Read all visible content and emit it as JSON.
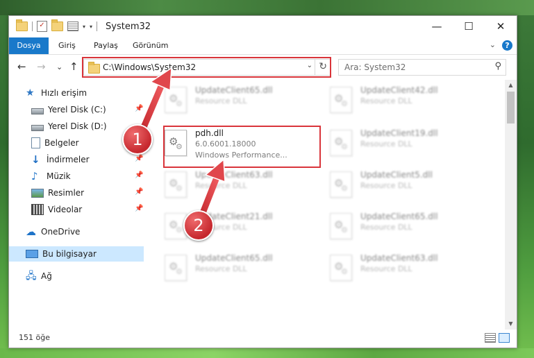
{
  "titlebar": {
    "title": "System32",
    "quick_access_dropdown_glyph": "▾",
    "customize_glyph": "▾",
    "minimize_glyph": "—",
    "maximize_glyph": "☐",
    "close_glyph": "✕"
  },
  "ribbon": {
    "tabs": [
      "Dosya",
      "Giriş",
      "Paylaş",
      "Görünüm"
    ],
    "expand_glyph": "⌄",
    "help_glyph": "?"
  },
  "nav": {
    "back_glyph": "←",
    "forward_glyph": "→",
    "recent_glyph": "⌄",
    "up_glyph": "↑"
  },
  "address": {
    "path": "C:\\Windows\\System32",
    "dropdown_glyph": "⌄",
    "refresh_glyph": "↻"
  },
  "search": {
    "placeholder": "Ara: System32",
    "search_glyph": "⚲"
  },
  "sidebar": {
    "items": [
      {
        "label": "Hızlı erişim",
        "icon": "star-icon",
        "pinned": false,
        "selected": false
      },
      {
        "label": "Yerel Disk (C:)",
        "icon": "drive-icon",
        "pinned": true,
        "selected": false
      },
      {
        "label": "Yerel Disk (D:)",
        "icon": "drive-icon",
        "pinned": false,
        "selected": false
      },
      {
        "label": "Belgeler",
        "icon": "documents-icon",
        "pinned": true,
        "selected": false
      },
      {
        "label": "İndirmeler",
        "icon": "downloads-icon",
        "pinned": true,
        "selected": false
      },
      {
        "label": "Müzik",
        "icon": "music-icon",
        "pinned": true,
        "selected": false
      },
      {
        "label": "Resimler",
        "icon": "pictures-icon",
        "pinned": true,
        "selected": false
      },
      {
        "label": "Videolar",
        "icon": "videos-icon",
        "pinned": true,
        "selected": false
      },
      {
        "label": "OneDrive",
        "icon": "onedrive-icon",
        "pinned": false,
        "selected": false
      },
      {
        "label": "Bu bilgisayar",
        "icon": "this-pc-icon",
        "pinned": false,
        "selected": true
      },
      {
        "label": "Ağ",
        "icon": "network-icon",
        "pinned": false,
        "selected": false
      }
    ],
    "pin_glyph": "📌"
  },
  "files": {
    "left_column": [
      {
        "name": "UpdateClient65.dll",
        "line1": "Resource DLL",
        "line2": "",
        "blurred": true
      },
      {
        "name": "pdh.dll",
        "line1": "6.0.6001.18000",
        "line2": "Windows Performance...",
        "blurred": false,
        "highlighted": true
      },
      {
        "name": "UpdateClient63.dll",
        "line1": "Resource DLL",
        "line2": "",
        "blurred": true
      },
      {
        "name": "UpdateClient21.dll",
        "line1": "Resource DLL",
        "line2": "",
        "blurred": true
      },
      {
        "name": "UpdateClient65.dll",
        "line1": "Resource DLL",
        "line2": "",
        "blurred": true
      }
    ],
    "right_column": [
      {
        "name": "UpdateClient42.dll",
        "line1": "Resource DLL",
        "line2": "",
        "blurred": true
      },
      {
        "name": "UpdateClient19.dll",
        "line1": "Resource DLL",
        "line2": "",
        "blurred": true
      },
      {
        "name": "UpdateClient5.dll",
        "line1": "Resource DLL",
        "line2": "",
        "blurred": true
      },
      {
        "name": "UpdateClient65.dll",
        "line1": "Resource DLL",
        "line2": "",
        "blurred": true
      },
      {
        "name": "UpdateClient63.dll",
        "line1": "Resource DLL",
        "line2": "",
        "blurred": true
      }
    ]
  },
  "scrollbar": {
    "up_glyph": "▲",
    "down_glyph": "▼"
  },
  "statusbar": {
    "count": "151 öğe"
  },
  "callouts": {
    "step1": "1",
    "step2": "2"
  },
  "colors": {
    "accent": "#1979ca",
    "highlight": "#d9343a",
    "selected_nav": "#cce8ff"
  }
}
